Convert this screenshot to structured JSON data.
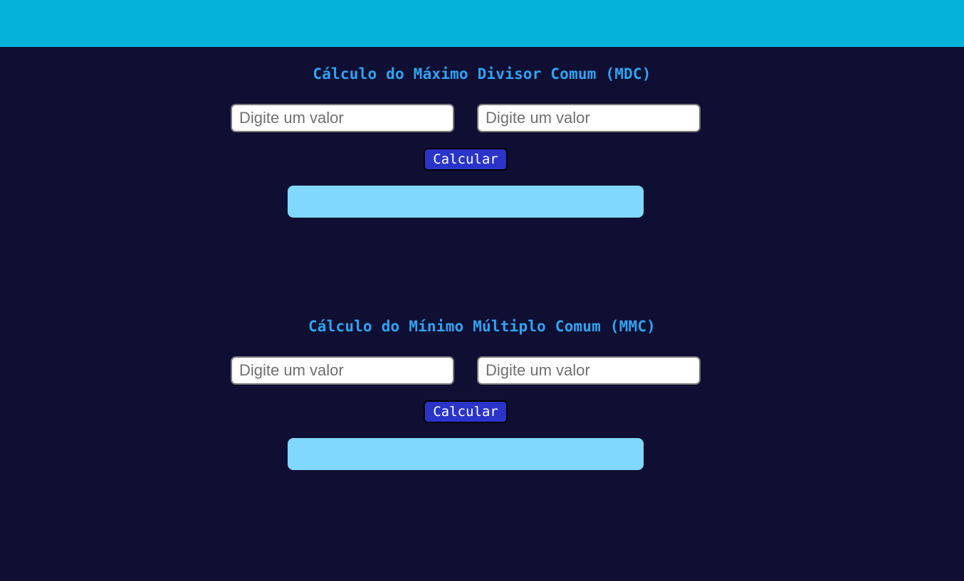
{
  "colors": {
    "header": "#04b2d9",
    "background": "#0f0f33",
    "title": "#2ea4f2",
    "button": "#2a34c8",
    "result_box": "#80d8ff"
  },
  "mdc": {
    "title": "Cálculo do Máximo Divisor Comum (MDC)",
    "input1_placeholder": "Digite um valor",
    "input1_value": "",
    "input2_placeholder": "Digite um valor",
    "input2_value": "",
    "button_label": "Calcular",
    "result": ""
  },
  "mmc": {
    "title": "Cálculo do Mínimo Múltiplo Comum (MMC)",
    "input1_placeholder": "Digite um valor",
    "input1_value": "",
    "input2_placeholder": "Digite um valor",
    "input2_value": "",
    "button_label": "Calcular",
    "result": ""
  }
}
